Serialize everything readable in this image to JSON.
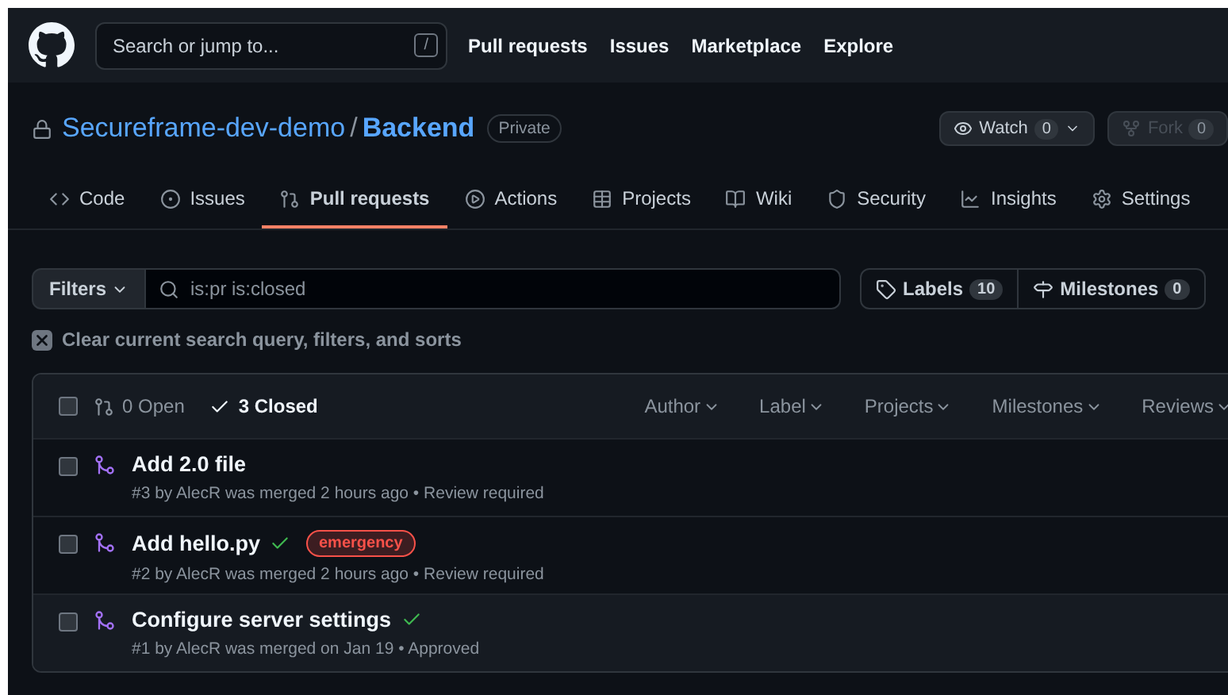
{
  "nav": {
    "search_placeholder": "Search or jump to...",
    "shortcut": "/",
    "links": [
      "Pull requests",
      "Issues",
      "Marketplace",
      "Explore"
    ]
  },
  "repo": {
    "owner": "Secureframe-dev-demo",
    "separator": "/",
    "name": "Backend",
    "visibility": "Private",
    "watch": {
      "label": "Watch",
      "count": "0",
      "disabled": false
    },
    "fork": {
      "label": "Fork",
      "count": "0",
      "disabled": true
    }
  },
  "tabs": [
    {
      "label": "Code",
      "selected": false
    },
    {
      "label": "Issues",
      "selected": false
    },
    {
      "label": "Pull requests",
      "selected": true
    },
    {
      "label": "Actions",
      "selected": false
    },
    {
      "label": "Projects",
      "selected": false
    },
    {
      "label": "Wiki",
      "selected": false
    },
    {
      "label": "Security",
      "selected": false
    },
    {
      "label": "Insights",
      "selected": false
    },
    {
      "label": "Settings",
      "selected": false
    }
  ],
  "filters": {
    "button": "Filters",
    "query": "is:pr is:closed",
    "labels": {
      "label": "Labels",
      "count": "10"
    },
    "milestones": {
      "label": "Milestones",
      "count": "0"
    },
    "clear": "Clear current search query, filters, and sorts"
  },
  "list": {
    "select_all_checked": false,
    "states": [
      {
        "label": "0 Open",
        "kind": "open",
        "selected": false
      },
      {
        "label": "3 Closed",
        "kind": "closed",
        "selected": true
      }
    ],
    "menus": [
      "Author",
      "Label",
      "Projects",
      "Milestones",
      "Reviews"
    ],
    "pulls": [
      {
        "title": "Add 2.0 file",
        "checks_passed": false,
        "meta": "#3 by AlecR was merged 2 hours ago • Review required",
        "checked": false
      },
      {
        "title": "Add hello.py",
        "checks_passed": true,
        "labels": [
          {
            "name": "emergency",
            "color": "#f85149"
          }
        ],
        "meta": "#2 by AlecR was merged 2 hours ago • Review required",
        "checked": false
      },
      {
        "title": "Configure server settings",
        "checks_passed": true,
        "meta": "#1 by AlecR was merged on Jan 19 • Approved",
        "checked": false
      }
    ]
  }
}
